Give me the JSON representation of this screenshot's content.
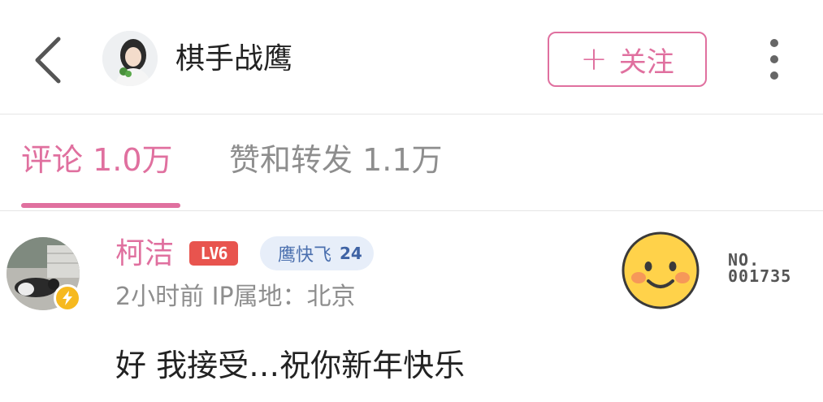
{
  "header": {
    "title": "棋手战鹰",
    "follow_label": "关注",
    "follow_plus": "+"
  },
  "tabs": [
    {
      "label": "评论 1.0万",
      "active": true
    },
    {
      "label": "赞和转发 1.1万",
      "active": false
    }
  ],
  "comment": {
    "username": "柯洁",
    "level": "LV6",
    "fan_badge_name": "鹰快飞",
    "fan_badge_level": "24",
    "meta": "2小时前 IP属地：北京",
    "content": "好 我接受…祝你新年快乐",
    "card_no_line1": "NO.",
    "card_no_line2": "001735"
  },
  "icons": [
    "back-chevron-icon",
    "more-vertical-icon",
    "lightning-icon",
    "smiley-face-icon"
  ],
  "colors": {
    "accent_pink": "#e0709f",
    "level_red": "#e8544e",
    "fan_badge_blue": "#3f63a4",
    "verify_gold": "#f6b91f",
    "muted_gray": "#8e8e8e"
  }
}
